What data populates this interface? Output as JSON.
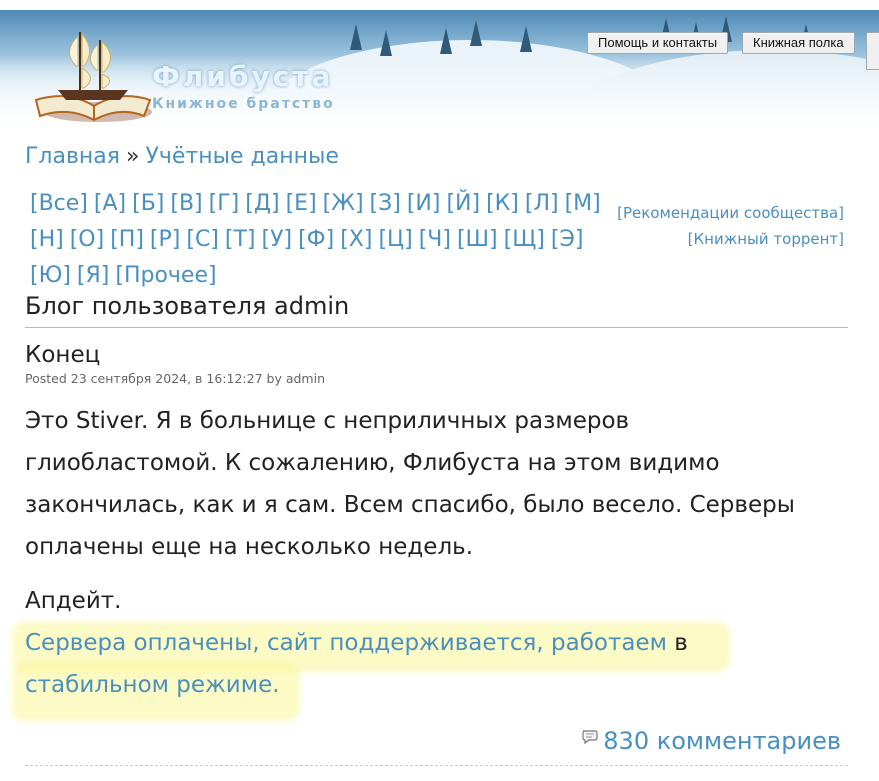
{
  "header": {
    "site_title": "Флибуста",
    "site_subtitle": "Книжное братство",
    "nav_buttons": [
      "Помощь и контакты",
      "Книжная полка"
    ]
  },
  "breadcrumb": {
    "home": "Главная",
    "separator": "»",
    "current": "Учётные данные"
  },
  "alphabet": [
    "[Все]",
    "[А]",
    "[Б]",
    "[В]",
    "[Г]",
    "[Д]",
    "[Е]",
    "[Ж]",
    "[З]",
    "[И]",
    "[Й]",
    "[К]",
    "[Л]",
    "[М]",
    "[Н]",
    "[О]",
    "[П]",
    "[Р]",
    "[С]",
    "[Т]",
    "[У]",
    "[Ф]",
    "[Х]",
    "[Ц]",
    "[Ч]",
    "[Ш]",
    "[Щ]",
    "[Э]",
    "[Ю]",
    "[Я]",
    "[Прочее]"
  ],
  "side_links": {
    "recommendations": "[Рекомендации сообщества]",
    "torrent": "[Книжный торрент]"
  },
  "blog": {
    "title": "Блог пользователя admin"
  },
  "post": {
    "title": "Конец",
    "meta": "Posted 23 сентября 2024, в 16:12:27 by admin",
    "body": "Это Stiver. Я в больнице с неприличных размеров глиобластомой. К сожалению, Флибуста на этом видимо закончилась, как и я сам. Всем спасибо, было весело. Серверы оплачены еще на несколько недель.",
    "update_label": "Апдейт.",
    "update_link_text": "Сервера оплачены, сайт поддерживается, работаем",
    "update_plain_text": " в",
    "update_link_text2": "стабильном режиме.",
    "comments": "830 комментариев"
  },
  "colors": {
    "link": "#4a90bf",
    "highlight": "#faf596"
  }
}
